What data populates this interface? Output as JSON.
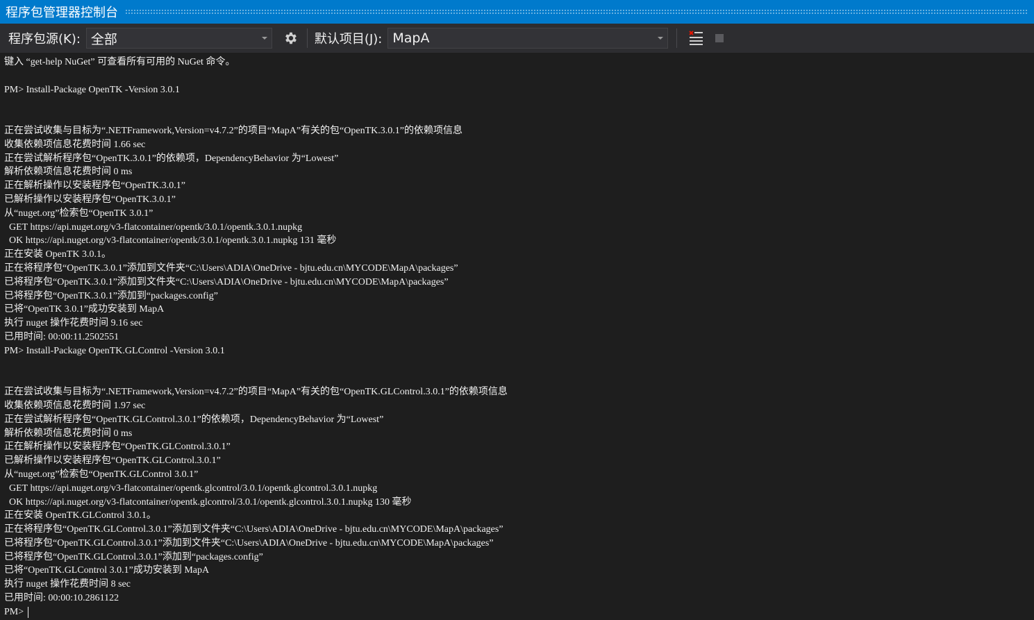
{
  "window": {
    "title": "程序包管理器控制台"
  },
  "toolbar": {
    "source_label": "程序包源(K):",
    "source_value": "全部",
    "project_label": "默认项目(J):",
    "project_value": "MapA",
    "icons": [
      "gear-icon",
      "clear-console-icon",
      "stop-icon"
    ]
  },
  "colors": {
    "titlebar": "#007acc",
    "toolbar": "#2d2d30",
    "console_bg": "#1e1e1e",
    "text": "#f1f1f1"
  },
  "console": {
    "lines": [
      "键入 “get-help NuGet” 可查看所有可用的 NuGet 命令。",
      "",
      "PM> Install-Package OpenTK -Version 3.0.1",
      "",
      "",
      "正在尝试收集与目标为“.NETFramework,Version=v4.7.2”的项目“MapA”有关的包“OpenTK.3.0.1”的依赖项信息",
      "收集依赖项信息花费时间 1.66 sec",
      "正在尝试解析程序包“OpenTK.3.0.1”的依赖项，DependencyBehavior 为“Lowest”",
      "解析依赖项信息花费时间 0 ms",
      "正在解析操作以安装程序包“OpenTK.3.0.1”",
      "已解析操作以安装程序包“OpenTK.3.0.1”",
      "从“nuget.org”检索包“OpenTK 3.0.1”",
      "  GET https://api.nuget.org/v3-flatcontainer/opentk/3.0.1/opentk.3.0.1.nupkg",
      "  OK https://api.nuget.org/v3-flatcontainer/opentk/3.0.1/opentk.3.0.1.nupkg 131 毫秒",
      "正在安装 OpenTK 3.0.1。",
      "正在将程序包“OpenTK.3.0.1”添加到文件夹“C:\\Users\\ADIA\\OneDrive - bjtu.edu.cn\\MYCODE\\MapA\\packages”",
      "已将程序包“OpenTK.3.0.1”添加到文件夹“C:\\Users\\ADIA\\OneDrive - bjtu.edu.cn\\MYCODE\\MapA\\packages”",
      "已将程序包“OpenTK.3.0.1”添加到“packages.config”",
      "已将“OpenTK 3.0.1”成功安装到 MapA",
      "执行 nuget 操作花费时间 9.16 sec",
      "已用时间: 00:00:11.2502551",
      "PM> Install-Package OpenTK.GLControl -Version 3.0.1",
      "",
      "",
      "正在尝试收集与目标为“.NETFramework,Version=v4.7.2”的项目“MapA”有关的包“OpenTK.GLControl.3.0.1”的依赖项信息",
      "收集依赖项信息花费时间 1.97 sec",
      "正在尝试解析程序包“OpenTK.GLControl.3.0.1”的依赖项，DependencyBehavior 为“Lowest”",
      "解析依赖项信息花费时间 0 ms",
      "正在解析操作以安装程序包“OpenTK.GLControl.3.0.1”",
      "已解析操作以安装程序包“OpenTK.GLControl.3.0.1”",
      "从“nuget.org”检索包“OpenTK.GLControl 3.0.1”",
      "  GET https://api.nuget.org/v3-flatcontainer/opentk.glcontrol/3.0.1/opentk.glcontrol.3.0.1.nupkg",
      "  OK https://api.nuget.org/v3-flatcontainer/opentk.glcontrol/3.0.1/opentk.glcontrol.3.0.1.nupkg 130 毫秒",
      "正在安装 OpenTK.GLControl 3.0.1。",
      "正在将程序包“OpenTK.GLControl.3.0.1”添加到文件夹“C:\\Users\\ADIA\\OneDrive - bjtu.edu.cn\\MYCODE\\MapA\\packages”",
      "已将程序包“OpenTK.GLControl.3.0.1”添加到文件夹“C:\\Users\\ADIA\\OneDrive - bjtu.edu.cn\\MYCODE\\MapA\\packages”",
      "已将程序包“OpenTK.GLControl.3.0.1”添加到“packages.config”",
      "已将“OpenTK.GLControl 3.0.1”成功安装到 MapA",
      "执行 nuget 操作花费时间 8 sec",
      "已用时间: 00:00:10.2861122"
    ],
    "prompt": "PM> "
  }
}
